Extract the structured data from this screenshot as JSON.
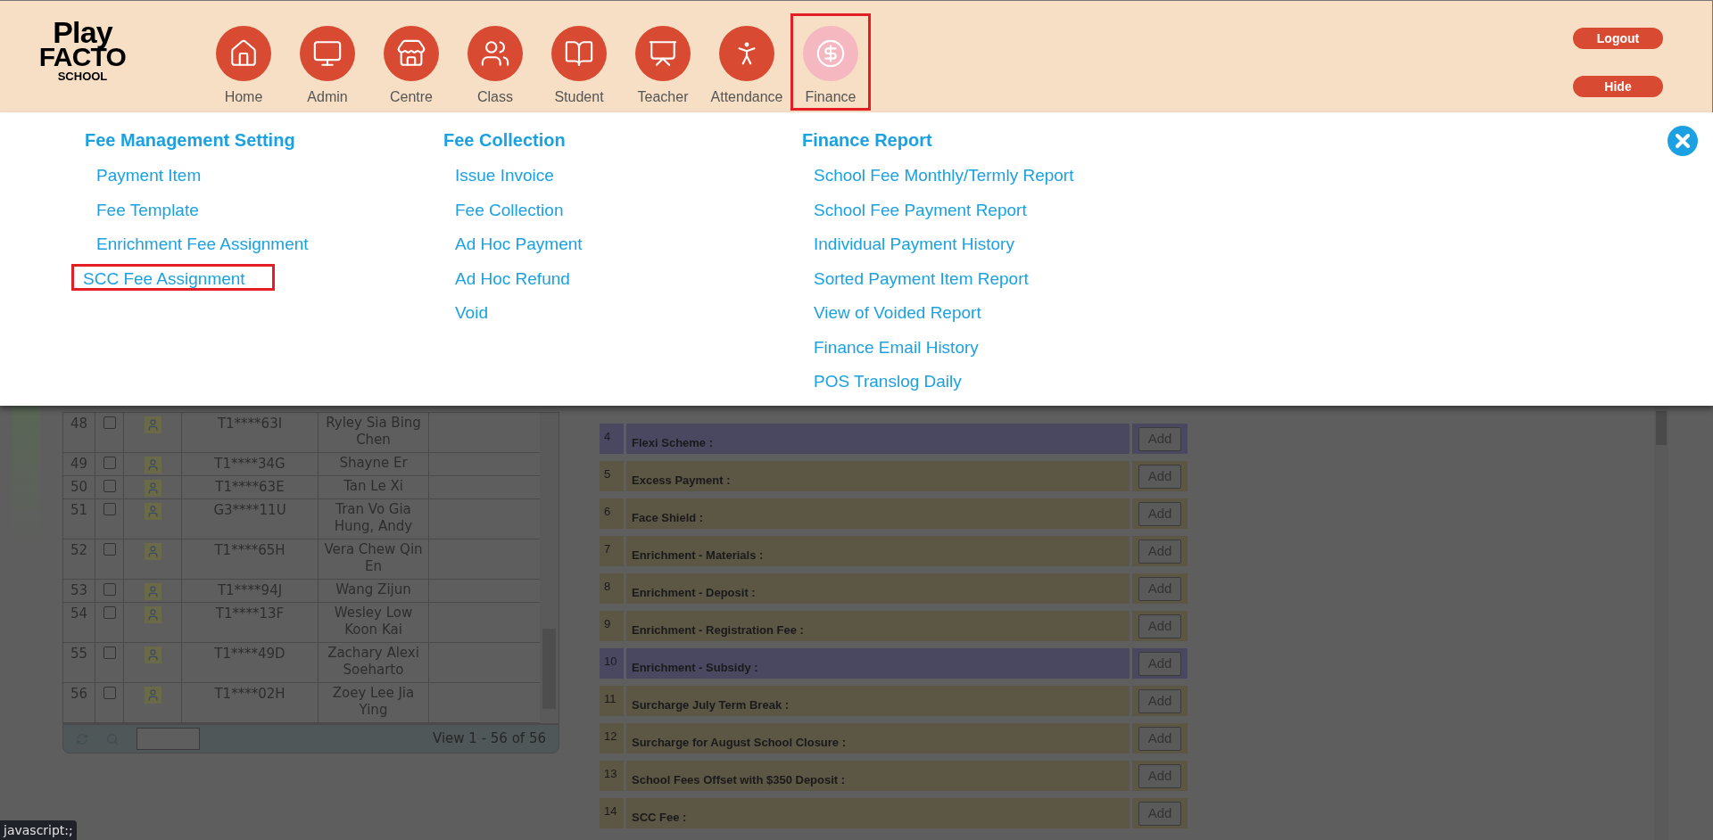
{
  "logo": {
    "line1": "Play",
    "line2": "FACTO",
    "line3": "SCHOOL"
  },
  "nav": [
    {
      "label": "Home",
      "selected": false
    },
    {
      "label": "Admin",
      "selected": false
    },
    {
      "label": "Centre",
      "selected": false
    },
    {
      "label": "Class",
      "selected": false
    },
    {
      "label": "Student",
      "selected": false
    },
    {
      "label": "Teacher",
      "selected": false
    },
    {
      "label": "Attendance",
      "selected": false
    },
    {
      "label": "Finance",
      "selected": true
    }
  ],
  "header_buttons": [
    "Logout",
    "Hide"
  ],
  "menu": {
    "columns": [
      {
        "heading": "Fee Management Setting",
        "items": [
          {
            "label": "Payment Item",
            "selected": false
          },
          {
            "label": "Fee Template",
            "selected": false
          },
          {
            "label": "Enrichment Fee Assignment",
            "selected": false
          },
          {
            "label": "SCC Fee Assignment",
            "selected": true
          }
        ]
      },
      {
        "heading": "Fee Collection",
        "items": [
          {
            "label": "Issue Invoice",
            "selected": false
          },
          {
            "label": "Fee Collection",
            "selected": false
          },
          {
            "label": "Ad Hoc Payment",
            "selected": false
          },
          {
            "label": "Ad Hoc Refund",
            "selected": false
          },
          {
            "label": "Void",
            "selected": false
          }
        ]
      },
      {
        "heading": "Finance Report",
        "items": [
          {
            "label": "School Fee Monthly/Termly Report",
            "selected": false
          },
          {
            "label": "School Fee Payment Report",
            "selected": false
          },
          {
            "label": "Individual Payment History",
            "selected": false
          },
          {
            "label": "Sorted Payment Item Report",
            "selected": false
          },
          {
            "label": "View of Voided Report",
            "selected": false
          },
          {
            "label": "Finance Email History",
            "selected": false
          },
          {
            "label": "POS Translog Daily",
            "selected": false
          }
        ]
      }
    ]
  },
  "student_table": {
    "rows": [
      {
        "no": "48",
        "checked": false,
        "nric": "T1****63I",
        "name": "Ryley Sia Bing Chen"
      },
      {
        "no": "49",
        "checked": false,
        "nric": "T1****34G",
        "name": "Shayne Er"
      },
      {
        "no": "50",
        "checked": false,
        "nric": "T1****63E",
        "name": "Tan Le Xi"
      },
      {
        "no": "51",
        "checked": false,
        "nric": "G3****11U",
        "name": "Tran Vo Gia Hung, Andy"
      },
      {
        "no": "52",
        "checked": false,
        "nric": "T1****65H",
        "name": "Vera Chew Qin En"
      },
      {
        "no": "53",
        "checked": false,
        "nric": "T1****94J",
        "name": "Wang Zijun"
      },
      {
        "no": "54",
        "checked": false,
        "nric": "T1****13F",
        "name": "Wesley Low Koon Kai"
      },
      {
        "no": "55",
        "checked": false,
        "nric": "T1****49D",
        "name": "Zachary Alexi Soeharto"
      },
      {
        "no": "56",
        "checked": false,
        "nric": "T1****02H",
        "name": "Zoey Lee Jia Ying"
      }
    ],
    "footer": {
      "view": "View 1 - 56 of 56"
    }
  },
  "fee_items": [
    {
      "no": "4",
      "label": "Flexi Scheme :",
      "color": "#4a4860",
      "button": "Add"
    },
    {
      "no": "5",
      "label": "Excess Payment :",
      "color": "#5c5645",
      "button": "Add"
    },
    {
      "no": "6",
      "label": "Face Shield :",
      "color": "#5c5645",
      "button": "Add"
    },
    {
      "no": "7",
      "label": "Enrichment - Materials :",
      "color": "#5c5645",
      "button": "Add"
    },
    {
      "no": "8",
      "label": "Enrichment - Deposit :",
      "color": "#5c5645",
      "button": "Add"
    },
    {
      "no": "9",
      "label": "Enrichment - Registration Fee :",
      "color": "#5c5645",
      "button": "Add"
    },
    {
      "no": "10",
      "label": "Enrichment - Subsidy :",
      "color": "#4a4860",
      "button": "Add"
    },
    {
      "no": "11",
      "label": "Surcharge July Term Break :",
      "color": "#5c5645",
      "button": "Add"
    },
    {
      "no": "12",
      "label": "Surcharge for August School Closure :",
      "color": "#5c5645",
      "button": "Add"
    },
    {
      "no": "13",
      "label": "School Fees Offset with $350 Deposit :",
      "color": "#5c5645",
      "button": "Add"
    },
    {
      "no": "14",
      "label": "SCC Fee :",
      "color": "#5c5645",
      "button": "Add"
    }
  ],
  "status_bar": "javascript:;"
}
